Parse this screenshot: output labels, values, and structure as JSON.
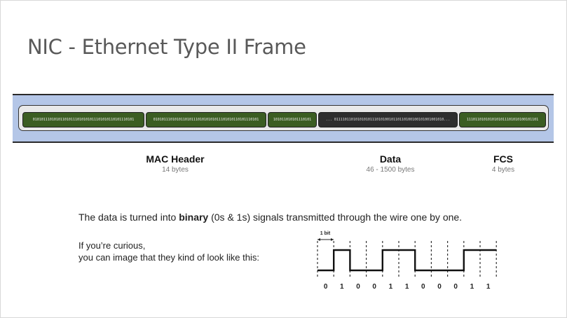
{
  "title": "NIC - Ethernet Type II Frame",
  "frame": {
    "segments": [
      {
        "bits": "010101110101011010111010101011101010110101110101",
        "style": "green"
      },
      {
        "bits": "01010111010101101011101010101011101010110101110101",
        "style": "green"
      },
      {
        "bits": "101011010101110101",
        "style": "green"
      },
      {
        "bits": "... 0111101101010101011101010010110110100100101001001010...",
        "style": "dark"
      },
      {
        "bits": "1110110101010101011101010100101101",
        "style": "green"
      }
    ],
    "labels": [
      {
        "name": "MAC Header",
        "size": "14 bytes"
      },
      {
        "name": "Data",
        "size": "46 - 1500 bytes"
      },
      {
        "name": "FCS",
        "size": "4 bytes"
      }
    ]
  },
  "explanation": {
    "before": "The data is turned into ",
    "bold": "binary",
    "after": " (0s & 1s) signals transmitted through the wire one by one."
  },
  "curious": {
    "line1": "If you’re curious,",
    "line2": "you can image that they kind of look like this:"
  },
  "signal": {
    "bit_label": "1 bit",
    "bits": [
      0,
      1,
      0,
      0,
      1,
      1,
      0,
      0,
      0,
      1,
      1
    ],
    "bit_text": [
      "0",
      "1",
      "0",
      "0",
      "1",
      "1",
      "0",
      "0",
      "0",
      "1",
      "1"
    ]
  }
}
